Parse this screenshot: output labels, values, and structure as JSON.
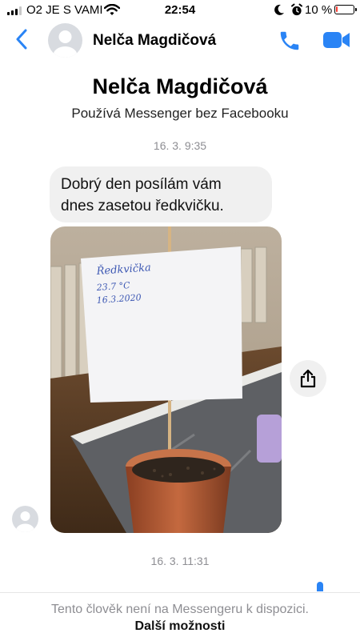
{
  "status_bar": {
    "carrier": "O2 JE S VAMI",
    "time": "22:54",
    "battery_text": "10 %",
    "battery_level": 0.1,
    "battery_color": "#ff3b30",
    "signal_bars": 3,
    "icons": [
      "wifi-icon",
      "moon-icon",
      "alarm-icon"
    ]
  },
  "header": {
    "contact_name": "Nelča Magdičová",
    "accent_color": "#2a84f5",
    "icons": [
      "back-chevron-icon",
      "phone-icon",
      "video-camera-icon"
    ]
  },
  "profile": {
    "name": "Nelča Magdičová",
    "subtitle": "Používá Messenger bez Facebooku"
  },
  "messages": [
    {
      "timestamp": "16. 3. 9:35",
      "bubble_lines": [
        "Dobrý den posílám vám",
        "dnes zasetou ředkvičku."
      ]
    }
  ],
  "photo": {
    "note_lines": [
      "Ředkvička",
      "23.7 °C",
      "16.3.2020"
    ]
  },
  "timestamp_2": "16. 3. 11:31",
  "footer": {
    "notice": "Tento člověk není na Messengeru k dispozici.",
    "link": "Další možnosti"
  }
}
